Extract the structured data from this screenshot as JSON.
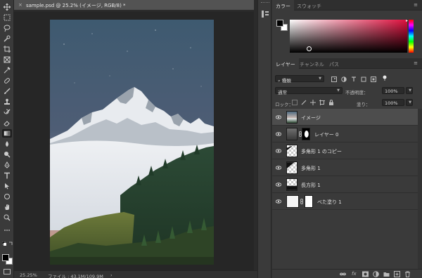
{
  "document": {
    "close_glyph": "×",
    "title": "sample.psd @ 25.2% (イメージ, RGB/8) *"
  },
  "status": {
    "zoom": "25.25%",
    "file_info": "ファイル : 43.1M/109.9M",
    "arrow": "›"
  },
  "toolbar": {
    "tools": [
      "move-icon",
      "marquee-icon",
      "lasso-icon",
      "quick-select-icon",
      "crop-icon",
      "frame-icon",
      "eyedropper-icon",
      "healing-icon",
      "brush-icon",
      "stamp-icon",
      "history-brush-icon",
      "eraser-icon",
      "gradient-icon",
      "blur-icon",
      "dodge-icon",
      "pen-icon",
      "type-icon",
      "path-select-icon",
      "shape-icon",
      "hand-icon",
      "zoom-icon",
      "more-icon"
    ],
    "active_tool": "gradient-icon"
  },
  "color_panel": {
    "tabs": [
      "カラー",
      "スウォッチ"
    ],
    "active_tab": "カラー",
    "foreground": "#000000",
    "background": "#ffffff",
    "hue": "#e0103e"
  },
  "layers_panel": {
    "tabs": [
      "レイヤー",
      "チャンネル",
      "パス"
    ],
    "active_tab": "レイヤー",
    "filter_kind": "種類",
    "blend_mode": "通常",
    "opacity_label": "不透明度：",
    "opacity": "100%",
    "lock_label": "ロック：",
    "fill_label": "塗り：",
    "fill": "100%",
    "layers": [
      {
        "name": "イメージ",
        "kind": "image",
        "selected": true
      },
      {
        "name": "レイヤー 0",
        "kind": "masked",
        "selected": false
      },
      {
        "name": "多角形 1 のコピー",
        "kind": "shape",
        "selected": false
      },
      {
        "name": "多角形 1",
        "kind": "shape",
        "selected": false
      },
      {
        "name": "長方形 1",
        "kind": "shape",
        "selected": false
      },
      {
        "name": "べた塗り 1",
        "kind": "fill",
        "selected": false
      }
    ]
  },
  "colors": {
    "ui_dark": "#262626",
    "panel": "#3a3a3a",
    "selected_row": "#4d4d4d"
  }
}
